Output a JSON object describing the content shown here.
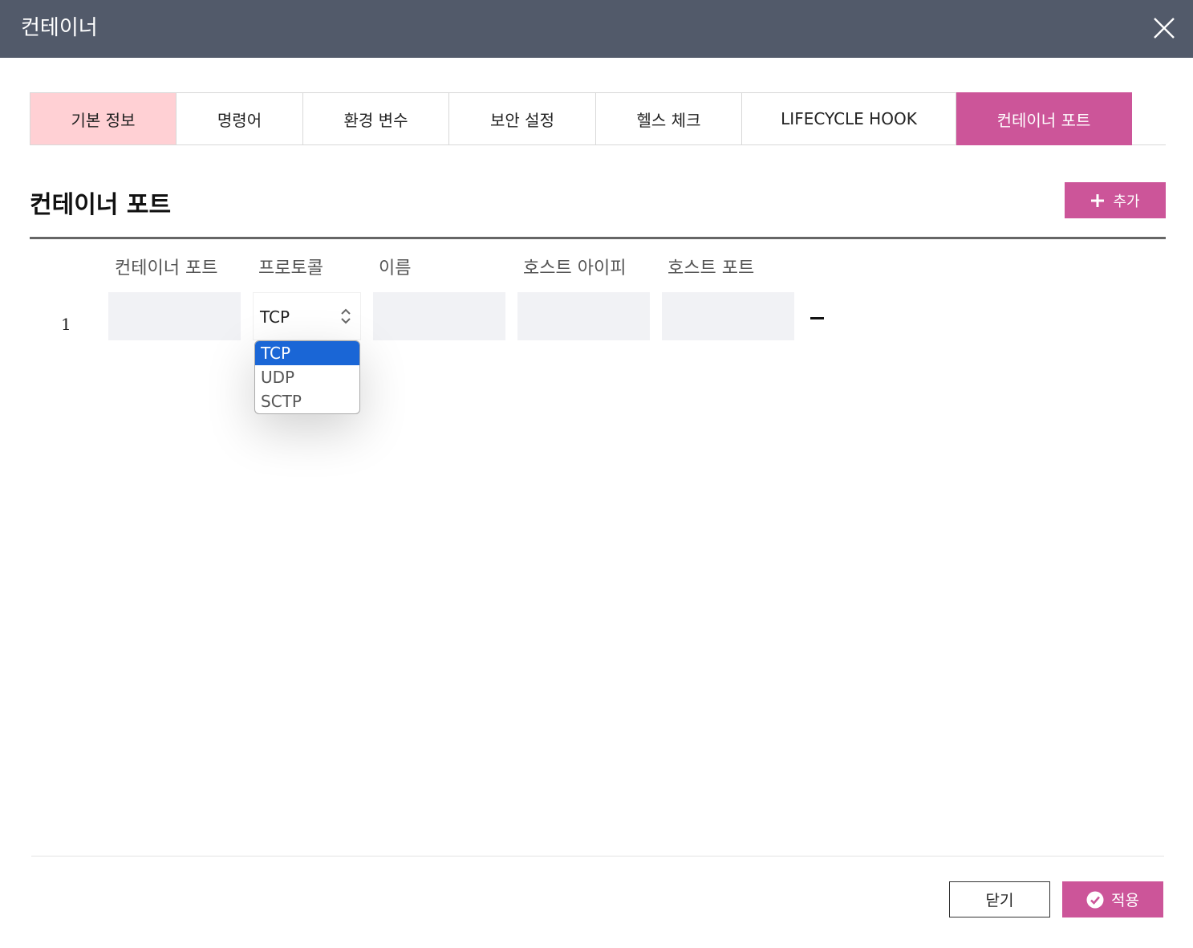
{
  "dialog": {
    "title": "컨테이너",
    "close_icon": "close-icon"
  },
  "tabs": [
    {
      "label": "기본 정보"
    },
    {
      "label": "명령어"
    },
    {
      "label": "환경 변수"
    },
    {
      "label": "보안 설정"
    },
    {
      "label": "헬스 체크"
    },
    {
      "label": "LIFECYCLE HOOK"
    },
    {
      "label": "컨테이너 포트",
      "active": true
    }
  ],
  "colors": {
    "titlebar": "#525a6a",
    "accent": "#cc5599",
    "tab_highlight": "#ffd0d4",
    "dropdown_selected": "#1a66d6"
  },
  "section": {
    "title": "컨테이너 포트",
    "add_label": "추가",
    "add_icon": "plus-icon"
  },
  "table": {
    "headers": [
      "컨테이너 포트",
      "프로토콜",
      "이름",
      "호스트 아이피",
      "호스트 포트"
    ],
    "rows": [
      {
        "index": "1",
        "container_port": "",
        "protocol": "TCP",
        "name": "",
        "host_ip": "",
        "host_port": ""
      }
    ]
  },
  "protocol_dropdown": {
    "options": [
      "TCP",
      "UDP",
      "SCTP"
    ],
    "selected": "TCP"
  },
  "footer": {
    "close_label": "닫기",
    "apply_label": "적용",
    "apply_icon": "check-circle-icon"
  }
}
